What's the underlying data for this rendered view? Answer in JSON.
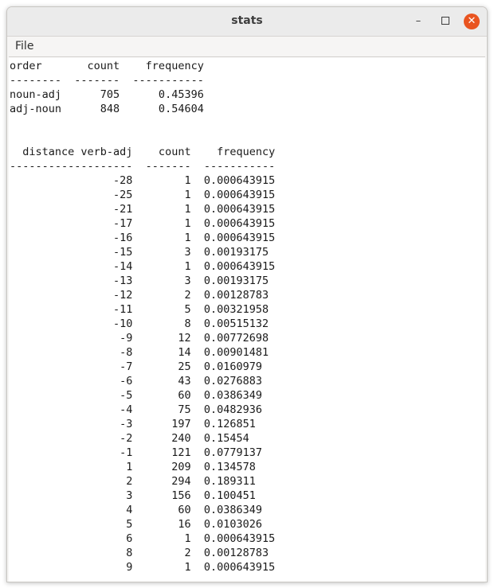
{
  "window": {
    "title": "stats",
    "buttons": {
      "minimize": "–",
      "maximize": "",
      "close": "✕"
    }
  },
  "menu": {
    "file": "File"
  },
  "text_lines": [
    "order       count    frequency",
    "--------  -------  -----------",
    "noun-adj      705      0.45396",
    "adj-noun      848      0.54604",
    "",
    "",
    "  distance verb-adj    count    frequency",
    "-------------------  -------  -----------",
    "                -28        1  0.000643915",
    "                -25        1  0.000643915",
    "                -21        1  0.000643915",
    "                -17        1  0.000643915",
    "                -16        1  0.000643915",
    "                -15        3  0.00193175",
    "                -14        1  0.000643915",
    "                -13        3  0.00193175",
    "                -12        2  0.00128783",
    "                -11        5  0.00321958",
    "                -10        8  0.00515132",
    "                 -9       12  0.00772698",
    "                 -8       14  0.00901481",
    "                 -7       25  0.0160979",
    "                 -6       43  0.0276883",
    "                 -5       60  0.0386349",
    "                 -4       75  0.0482936",
    "                 -3      197  0.126851",
    "                 -2      240  0.15454",
    "                 -1      121  0.0779137",
    "                  1      209  0.134578",
    "                  2      294  0.189311",
    "                  3      156  0.100451",
    "                  4       60  0.0386349",
    "                  5       16  0.0103026",
    "                  6        1  0.000643915",
    "                  8        2  0.00128783",
    "                  9        1  0.000643915"
  ]
}
